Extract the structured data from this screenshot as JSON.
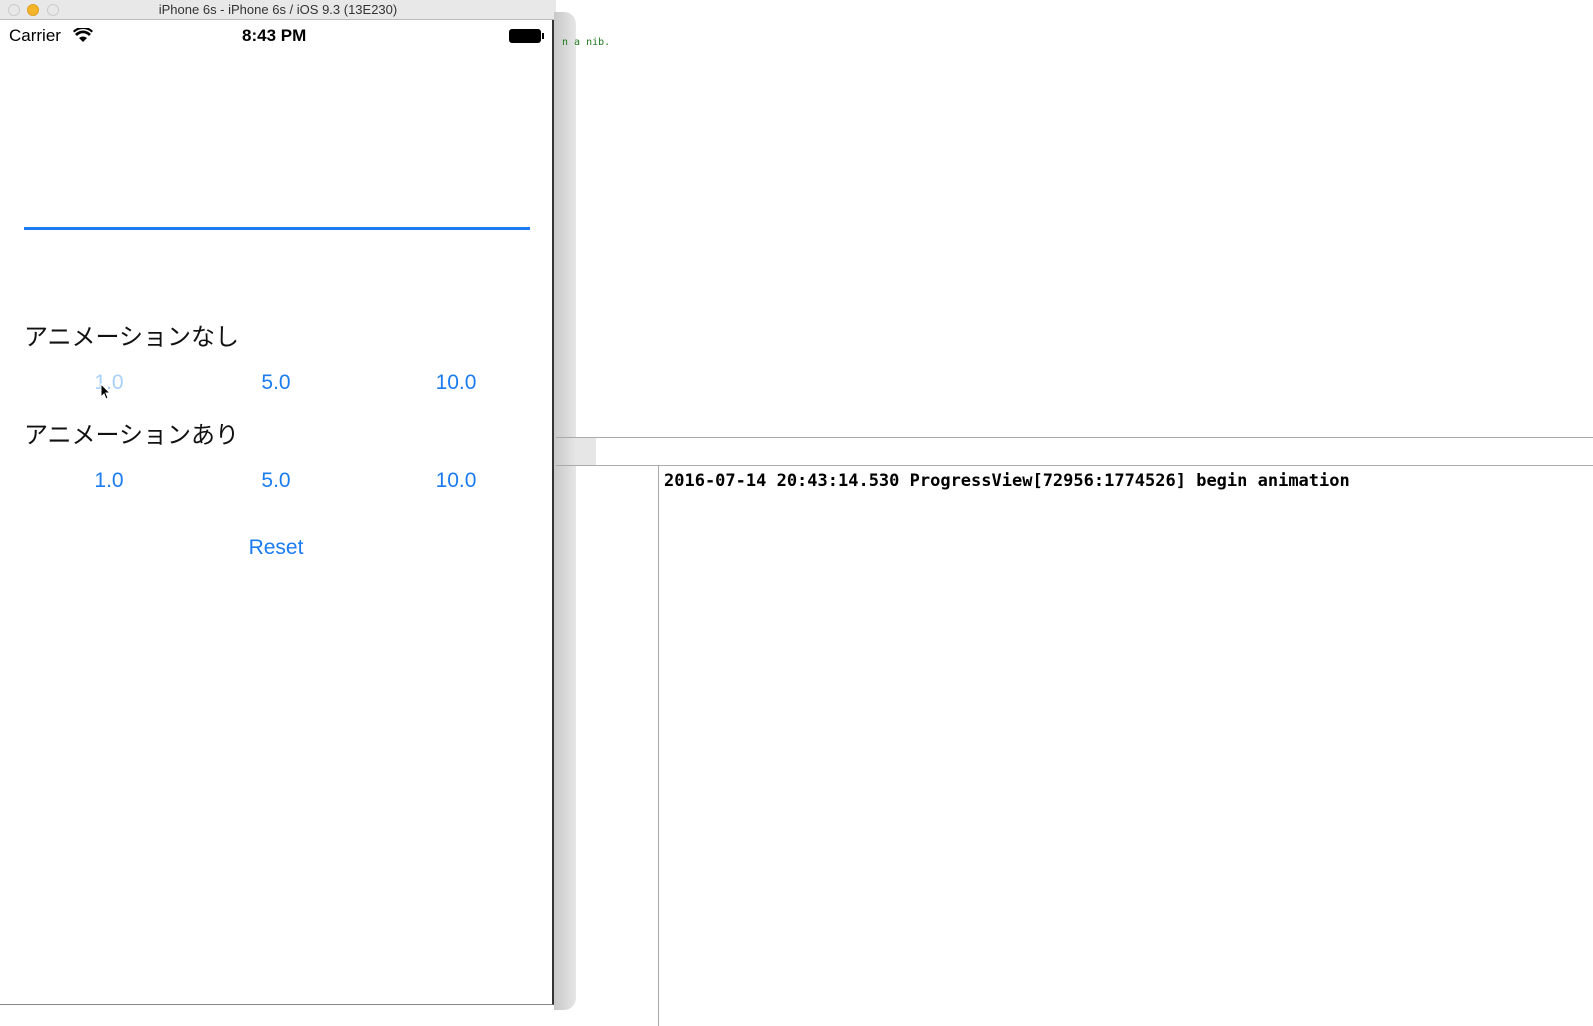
{
  "window": {
    "title": "iPhone 6s - iPhone 6s / iOS 9.3 (13E230)"
  },
  "status_bar": {
    "carrier": "Carrier",
    "time": "8:43 PM"
  },
  "progress": {
    "value": 1.0,
    "color": "#1a7cf0"
  },
  "section_no_anim": {
    "label": "アニメーションなし",
    "buttons": [
      "1.0",
      "5.0",
      "10.0"
    ]
  },
  "section_anim": {
    "label": "アニメーションあり",
    "buttons": [
      "1.0",
      "5.0",
      "10.0"
    ]
  },
  "reset_label": "Reset",
  "editor": {
    "code_fragment": "n a nib."
  },
  "console": {
    "line": "2016-07-14 20:43:14.530 ProgressView[72956:1774526] begin animation"
  }
}
